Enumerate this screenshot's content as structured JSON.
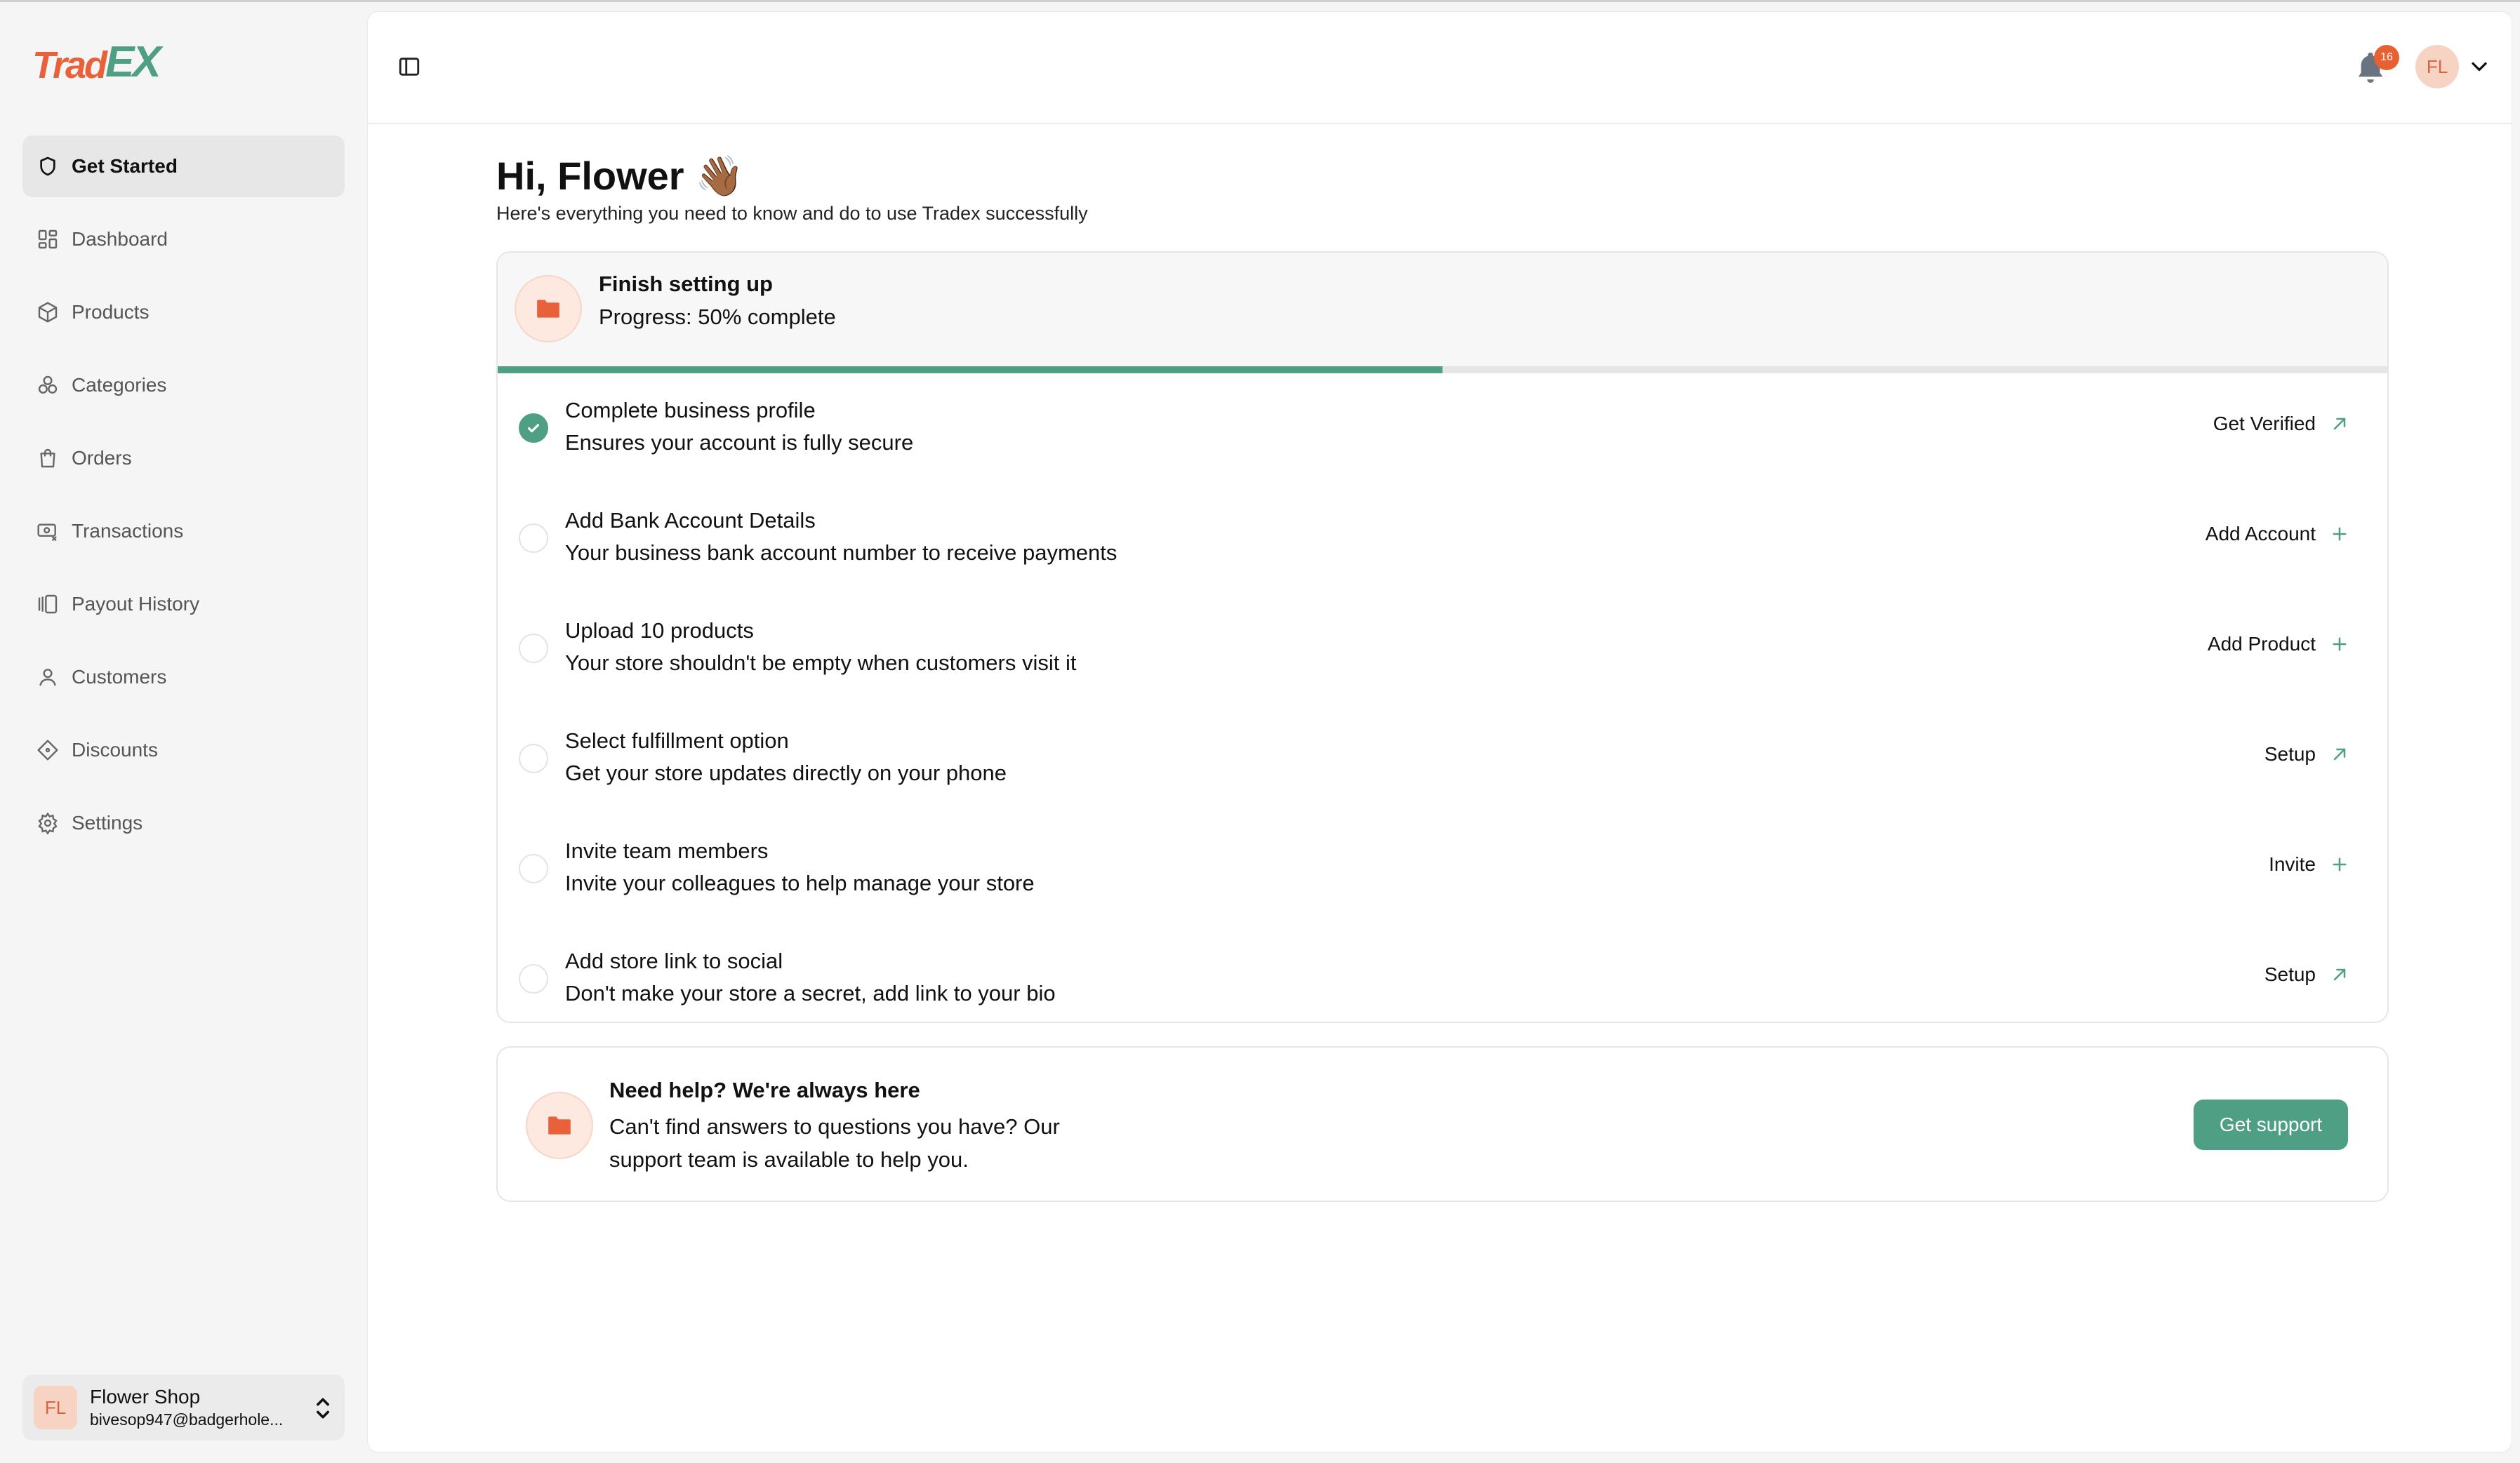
{
  "brand": {
    "logo_part1": "Trad",
    "logo_part2": "EX",
    "primary_color": "#e8613a",
    "accent_color": "#4e9f83"
  },
  "sidebar": {
    "items": [
      {
        "label": "Get Started",
        "icon": "shield-icon",
        "active": true
      },
      {
        "label": "Dashboard",
        "icon": "dashboard-icon"
      },
      {
        "label": "Products",
        "icon": "box-icon"
      },
      {
        "label": "Categories",
        "icon": "categories-icon"
      },
      {
        "label": "Orders",
        "icon": "shopping-bag-icon"
      },
      {
        "label": "Transactions",
        "icon": "transactions-icon"
      },
      {
        "label": "Payout History",
        "icon": "payout-icon"
      },
      {
        "label": "Customers",
        "icon": "user-icon"
      },
      {
        "label": "Discounts",
        "icon": "tag-icon"
      },
      {
        "label": "Settings",
        "icon": "gear-icon"
      }
    ],
    "user": {
      "initials": "FL",
      "name": "Flower Shop",
      "email": "bivesop947@badgerhole..."
    }
  },
  "topbar": {
    "notification_count": "16",
    "avatar_initials": "FL"
  },
  "greeting": {
    "title": "Hi, Flower 👋🏾",
    "subtitle": "Here's everything you need to know and do to use Tradex successfully"
  },
  "setup": {
    "title": "Finish setting up",
    "progress_text": "Progress: 50% complete",
    "progress_fraction": 0.5,
    "tasks": [
      {
        "title": "Complete business profile",
        "description": "Ensures your account is fully secure",
        "done": true,
        "action": "Get Verified",
        "action_icon": "arrow-up-right-icon"
      },
      {
        "title": "Add Bank Account Details",
        "description": "Your business bank account number to receive payments",
        "done": false,
        "action": "Add Account",
        "action_icon": "plus-icon"
      },
      {
        "title": "Upload 10 products",
        "description": "Your store shouldn't be empty when customers visit it",
        "done": false,
        "action": "Add Product",
        "action_icon": "plus-icon"
      },
      {
        "title": "Select fulfillment option",
        "description": "Get your store updates directly on your phone",
        "done": false,
        "action": "Setup",
        "action_icon": "arrow-up-right-icon"
      },
      {
        "title": "Invite team members",
        "description": "Invite your colleagues to help manage your store",
        "done": false,
        "action": "Invite",
        "action_icon": "plus-icon"
      },
      {
        "title": "Add store link to social",
        "description": "Don't make your store a secret, add link to your bio",
        "done": false,
        "action": "Setup",
        "action_icon": "arrow-up-right-icon"
      }
    ]
  },
  "help": {
    "title": "Need help? We're always here",
    "description": "Can't find answers to questions you have? Our support team is available to help you.",
    "button": "Get support"
  }
}
